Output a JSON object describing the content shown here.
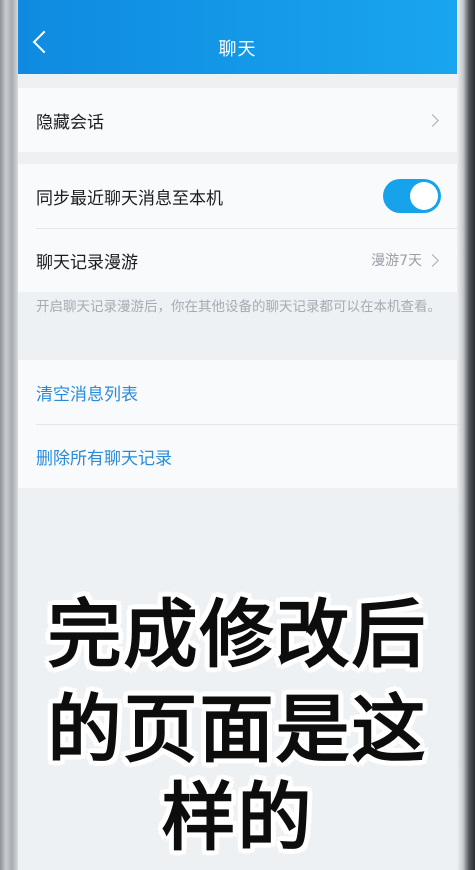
{
  "header": {
    "title": "聊天"
  },
  "hidden_section": {
    "label": "隐藏会话"
  },
  "sync_section": {
    "sync_label": "同步最近聊天消息至本机",
    "sync_enabled": true,
    "roaming_label": "聊天记录漫游",
    "roaming_value": "漫游7天",
    "hint": "开启聊天记录漫游后，你在其他设备的聊天记录都可以在本机查看。"
  },
  "actions": {
    "clear_label": "清空消息列表",
    "delete_label": "删除所有聊天记录"
  },
  "overlay_caption": {
    "line1": "完成修改后",
    "line2": "的页面是这",
    "line3": "样的"
  },
  "colors": {
    "accent": "#17a3ec",
    "link": "#2a8bd9"
  }
}
